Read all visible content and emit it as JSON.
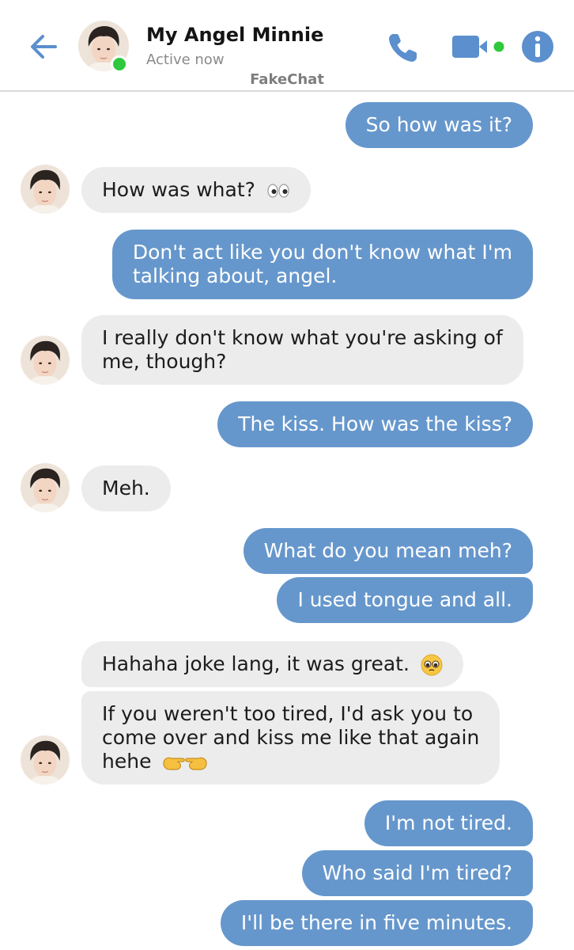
{
  "header": {
    "contact_name": "My Angel Minnie",
    "status": "Active now",
    "watermark": "FakeChat",
    "back_icon": "arrow-left-icon",
    "call_icon": "phone-icon",
    "video_icon": "video-camera-icon",
    "info_icon": "info-icon",
    "online_indicator_color": "#2ec93c",
    "accent_color": "#5b8fcd"
  },
  "messages": [
    {
      "from": "me",
      "text": "So how was it?"
    },
    {
      "from": "them",
      "text": "How was what?",
      "emoji": "eyes"
    },
    {
      "from": "me",
      "line1": "Don't act like you don't know what I'm",
      "line2": "talking about, angel."
    },
    {
      "from": "them",
      "line1": "I really don't know what you're asking of",
      "line2": "me, though?"
    },
    {
      "from": "me",
      "text": "The kiss. How was the kiss?"
    },
    {
      "from": "them",
      "text": "Meh."
    },
    {
      "from": "me",
      "text": "What do you mean meh?"
    },
    {
      "from": "me",
      "text": "I used tongue and all."
    },
    {
      "from": "them",
      "text": "Hahaha joke lang, it was great.",
      "emoji": "pleading-face"
    },
    {
      "from": "them",
      "line1": "If you weren't too tired, I'd ask you to",
      "line2": "come over and kiss me like that again",
      "line3": "hehe",
      "emoji": "pointing-fingers"
    },
    {
      "from": "me",
      "text": "I'm not tired."
    },
    {
      "from": "me",
      "text": "Who said I'm tired?"
    },
    {
      "from": "me",
      "text": "I'll be there in five minutes."
    }
  ],
  "colors": {
    "sent_bubble": "#6697cc",
    "received_bubble": "#ececec"
  }
}
